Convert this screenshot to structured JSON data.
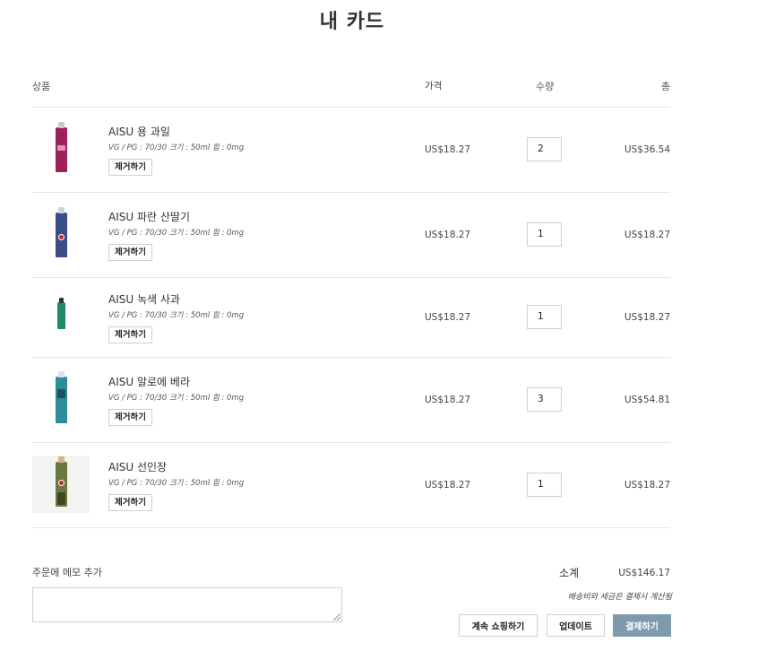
{
  "page": {
    "title": "내 카드"
  },
  "table_header": {
    "product": "상품",
    "price": "가격",
    "quantity": "수량",
    "total": "총"
  },
  "items": [
    {
      "name": "AISU 용 과일",
      "variant": "VG / PG : 70/30 크기 : 50ml 힘 : 0mg",
      "remove_label": "제거하기",
      "price": "US$18.27",
      "quantity": "2",
      "total": "US$36.54",
      "bottle_color": "#a0205e",
      "cap_color": "#c9c9c9",
      "boxed": false
    },
    {
      "name": "AISU 파란 산딸기",
      "variant": "VG / PG : 70/30 크기 : 50ml 힘 : 0mg",
      "remove_label": "제거하기",
      "price": "US$18.27",
      "quantity": "1",
      "total": "US$18.27",
      "bottle_color": "#3d4d8a",
      "cap_color": "#cfd3dc",
      "boxed": false
    },
    {
      "name": "AISU 녹색 사과",
      "variant": "VG / PG : 70/30 크기 : 50ml 힘 : 0mg",
      "remove_label": "제거하기",
      "price": "US$18.27",
      "quantity": "1",
      "total": "US$18.27",
      "bottle_color": "#1e8a6a",
      "cap_color": "#2b3a36",
      "boxed": false
    },
    {
      "name": "AISU 알로에 베라",
      "variant": "VG / PG : 70/30 크기 : 50ml 힘 : 0mg",
      "remove_label": "제거하기",
      "price": "US$18.27",
      "quantity": "3",
      "total": "US$54.81",
      "bottle_color": "#2e8c9a",
      "cap_color": "#d6e2e4",
      "boxed": false
    },
    {
      "name": "AISU 선인장",
      "variant": "VG / PG : 70/30 크기 : 50ml 힘 : 0mg",
      "remove_label": "제거하기",
      "price": "US$18.27",
      "quantity": "1",
      "total": "US$18.27",
      "bottle_color": "#6a7a3e",
      "cap_color": "#c9b98a",
      "boxed": true
    }
  ],
  "note": {
    "label": "주문에 메모 추가",
    "value": ""
  },
  "summary": {
    "subtotal_label": "소계",
    "subtotal_value": "US$146.17",
    "shipping_note": "배송비와 세금은 결제시 계산됨"
  },
  "buttons": {
    "continue_shopping": "계속 쇼핑하기",
    "update": "업데이트",
    "checkout": "결제하기"
  }
}
